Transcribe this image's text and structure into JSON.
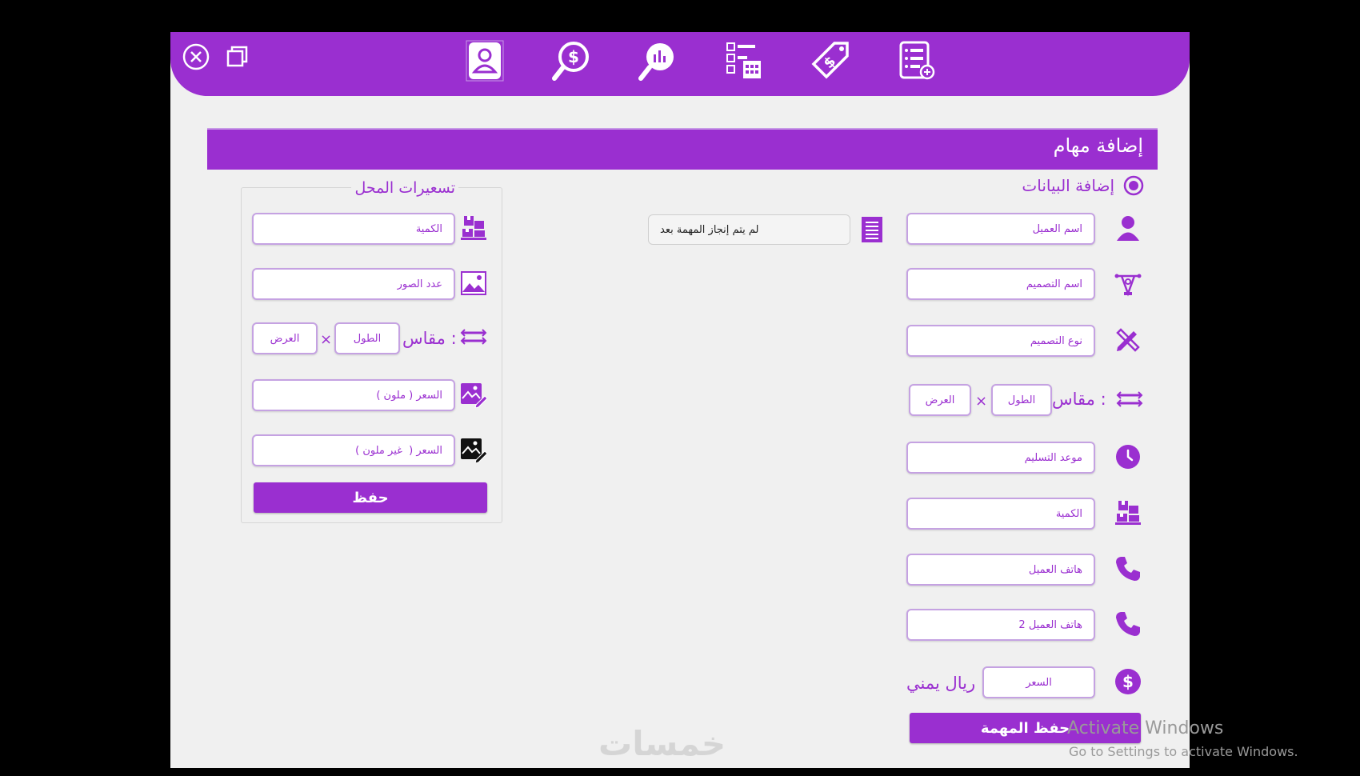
{
  "window": {
    "controls": {
      "close": "close-icon",
      "restore": "restore-icon"
    },
    "nav_icons": [
      "user-profile-icon",
      "search-money-icon",
      "search-chart-icon",
      "checklist-calendar-icon",
      "price-tag-icon",
      "task-list-icon"
    ]
  },
  "header": {
    "title": "إضافة مهام"
  },
  "add_data": {
    "title": "إضافة البيانات",
    "client_name": "اسم العميل",
    "design_name": "اسم التصميم",
    "design_type": "نوع التصميم",
    "size_label": "مقاس :",
    "length": "الطول",
    "width": "العرض",
    "times": "×",
    "delivery_date": "موعد التسليم",
    "quantity": "الكمية",
    "client_phone": "هاتف العميل",
    "client_phone2": "هاتف العميل 2",
    "price": "السعر",
    "currency": "ريال يمني",
    "save_task": "حفظ المهمة"
  },
  "status": {
    "text": "لم يتم إنجاز المهمة بعد"
  },
  "shop_pricing": {
    "title": "تسعيرات المحل",
    "quantity": "الكمية",
    "photo_count": "عدد الصور",
    "size_label": "مقاس :",
    "length": "الطول",
    "width": "العرض",
    "times": "×",
    "price_color": "السعر ( ملون )",
    "price_nocolor": "السعر (  غير ملون )",
    "save": "حفظ"
  },
  "watermark": {
    "brand": "خمسات",
    "activate_title": "Activate Windows",
    "activate_sub": "Go to Settings to activate Windows."
  },
  "colors": {
    "accent": "#9a2fd0",
    "background": "#f0f0f0",
    "field_border": "#c5a2e2"
  }
}
